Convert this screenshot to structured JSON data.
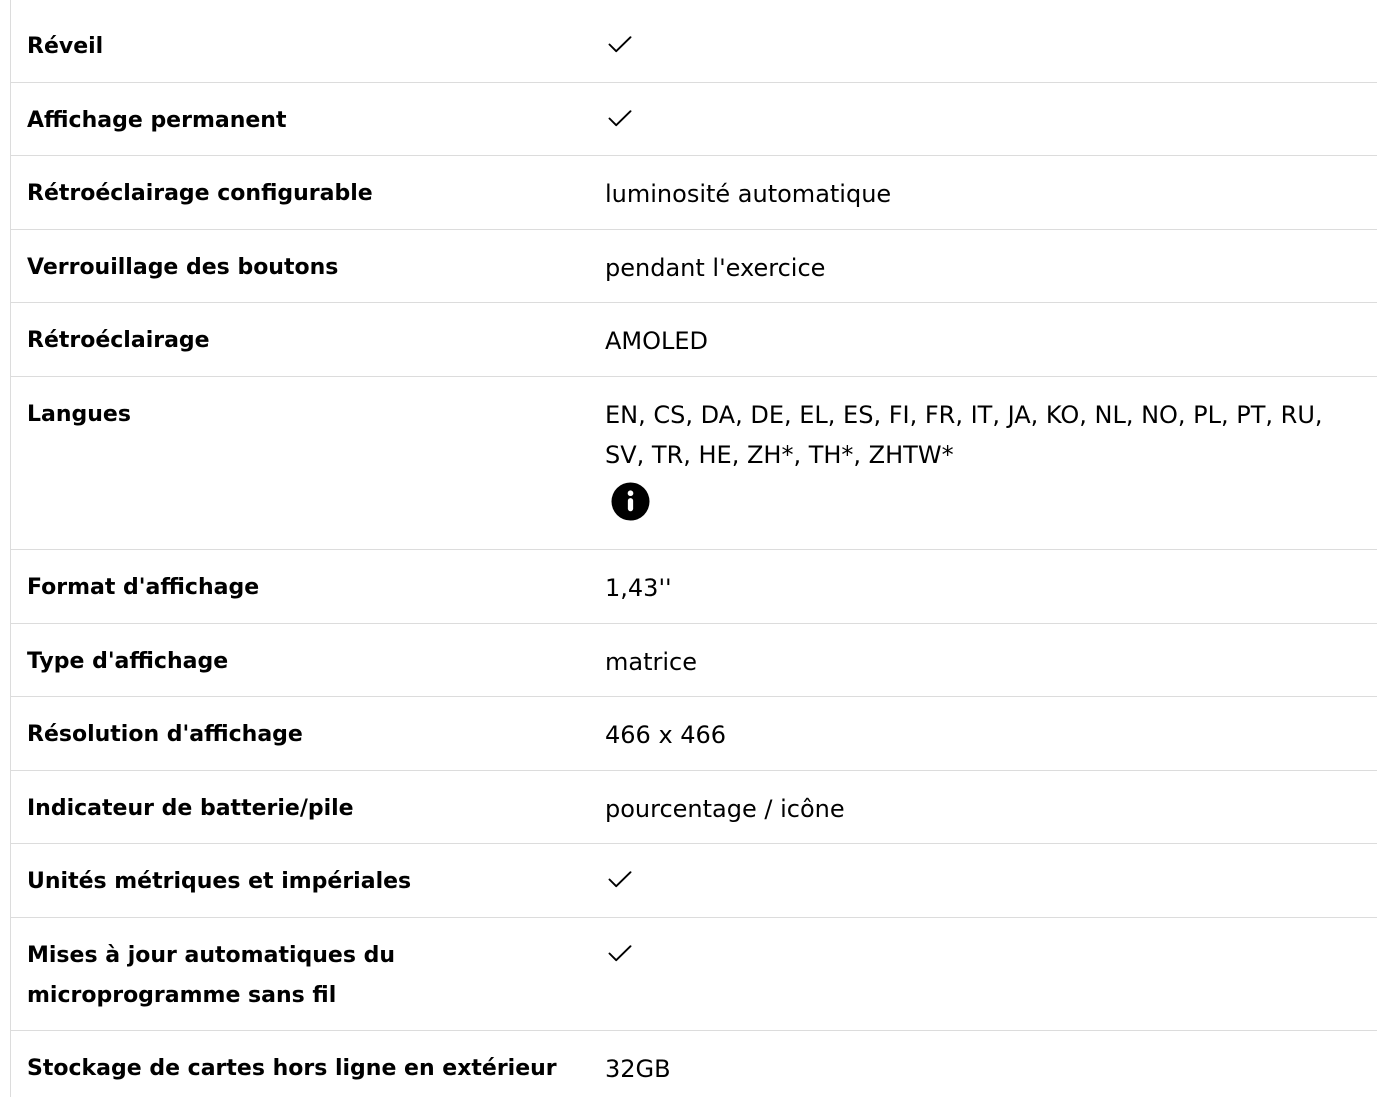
{
  "specs": [
    {
      "label": "Réveil",
      "icon": "check-icon"
    },
    {
      "label": "Affichage permanent",
      "icon": "check-icon"
    },
    {
      "label": "Rétroéclairage configurable",
      "value": "luminosité automatique"
    },
    {
      "label": "Verrouillage des boutons",
      "value": "pendant l'exercice"
    },
    {
      "label": "Rétroéclairage",
      "value": "AMOLED"
    },
    {
      "label": "Langues",
      "value": "EN, CS, DA, DE, EL, ES, FI, FR, IT, JA, KO, NL, NO, PL, PT, RU, SV, TR, HE, ZH*, TH*, ZHTW*",
      "icon": "info-icon"
    },
    {
      "label": "Format d'affichage",
      "value": "1,43''"
    },
    {
      "label": "Type d'affichage",
      "value": "matrice"
    },
    {
      "label": "Résolution d'affichage",
      "value": "466 x 466"
    },
    {
      "label": "Indicateur de batterie/pile",
      "value": "pourcentage / icône"
    },
    {
      "label": "Unités métriques et impériales",
      "icon": "check-icon"
    },
    {
      "label": "Mises à jour automatiques du microprogramme sans fil",
      "icon": "check-icon"
    },
    {
      "label": "Stockage de cartes hors ligne en extérieur",
      "value": "32GB"
    }
  ],
  "colors": {
    "text": "#000000",
    "divider": "#dcdcdc",
    "icon": "#000000"
  }
}
